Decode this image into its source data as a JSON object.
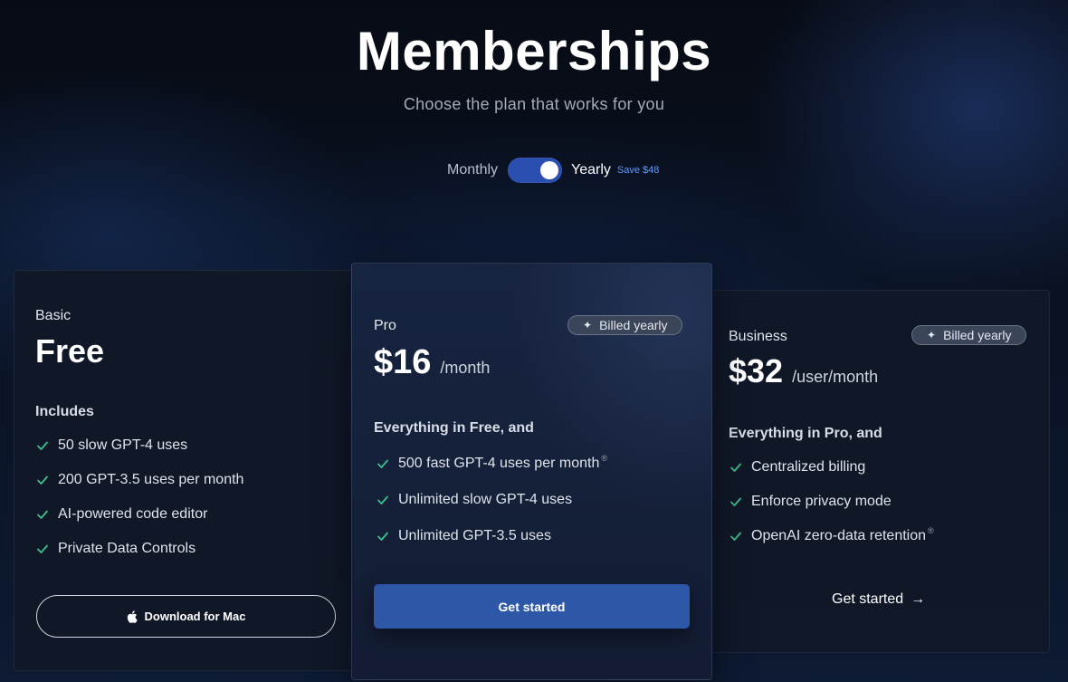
{
  "header": {
    "title": "Memberships",
    "subtitle": "Choose the plan that works for you"
  },
  "billing_toggle": {
    "monthly_label": "Monthly",
    "yearly_label": "Yearly",
    "save_label": "Save $48",
    "selected": "Yearly"
  },
  "plans": [
    {
      "name": "Basic",
      "price": "Free",
      "section_title": "Includes",
      "features": [
        "50 slow GPT-4 uses",
        "200 GPT-3.5 uses per month",
        "AI-powered code editor",
        "Private Data Controls"
      ],
      "cta_label": "Download for Mac",
      "cta_icon": "apple-icon"
    },
    {
      "name": "Pro",
      "badge": "Billed yearly",
      "price": "$16",
      "price_suffix": "/month",
      "section_title": "Everything in Free, and",
      "features": [
        "500 fast GPT-4 uses per month",
        "Unlimited slow GPT-4 uses",
        "Unlimited GPT-3.5 uses"
      ],
      "cta_label": "Get started"
    },
    {
      "name": "Business",
      "badge": "Billed yearly",
      "price": "$32",
      "price_suffix": "/user/month",
      "section_title": "Everything in Pro, and",
      "features": [
        "Centralized billing",
        "Enforce privacy mode",
        "OpenAI zero-data retention"
      ],
      "cta_label": "Get started",
      "cta_icon": "arrow-right-icon"
    }
  ],
  "colors": {
    "accent": "#2d58a8",
    "toggle": "#2a4fb0",
    "check": "#3fbf8f",
    "save_text": "#5b9bff"
  }
}
